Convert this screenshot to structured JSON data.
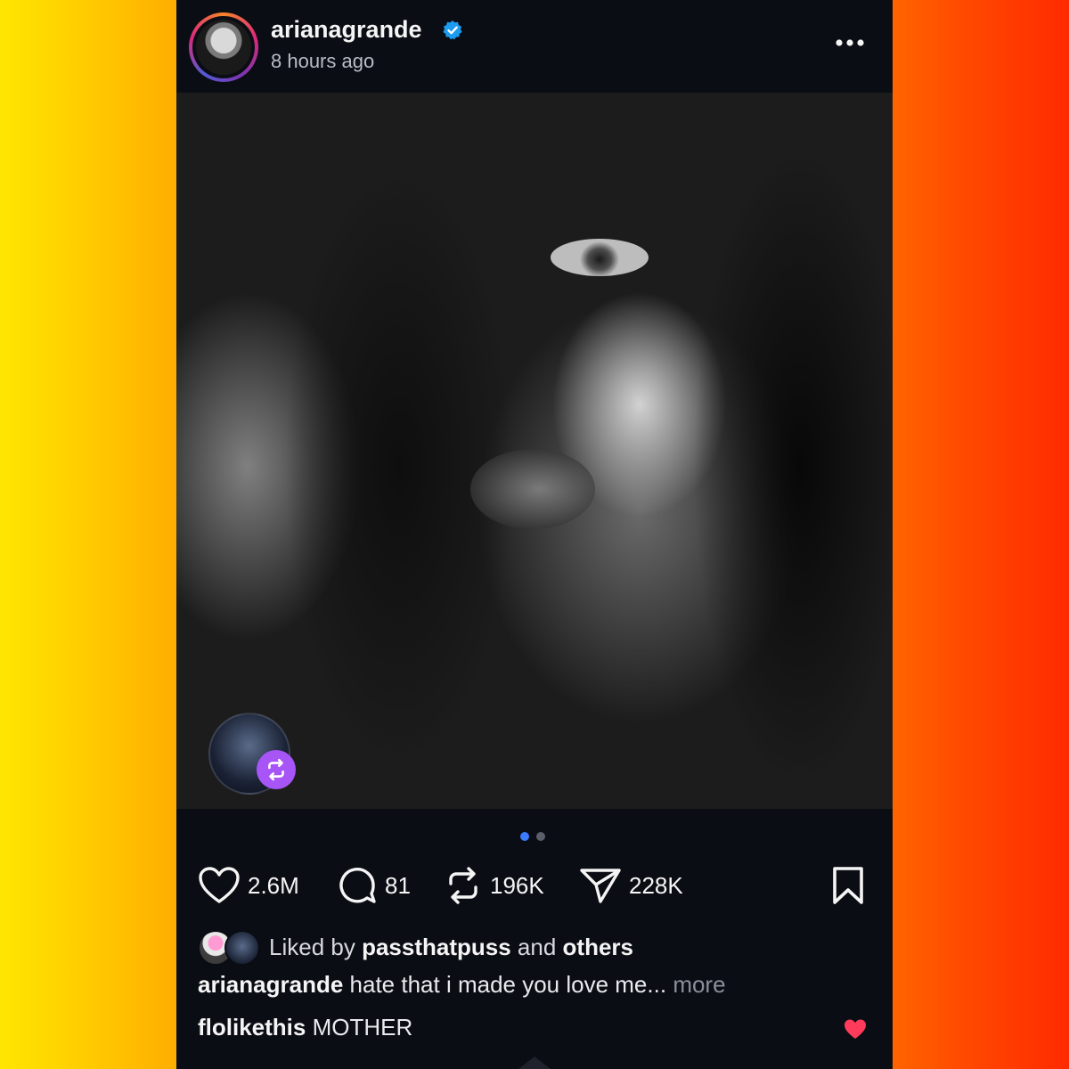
{
  "post": {
    "username": "arianagrande",
    "time": "8 hours ago",
    "verified": true
  },
  "carousel": {
    "current": 1,
    "total": 2
  },
  "actions": {
    "likes": "2.6M",
    "comments": "81",
    "reposts": "196K",
    "shares": "228K"
  },
  "liked_by": {
    "prefix": "Liked by",
    "user": "passthatpuss",
    "joiner": "and",
    "suffix": "others"
  },
  "caption": {
    "username": "arianagrande",
    "text": "hate that i made you love me...",
    "more": "more"
  },
  "comment": {
    "username": "flolikethis",
    "text": "MOTHER"
  },
  "colors": {
    "card_bg": "#0b0d14",
    "accent_blue": "#3d7bff",
    "repost_badge": "#a855f7",
    "like_red": "#ff3b5c"
  }
}
